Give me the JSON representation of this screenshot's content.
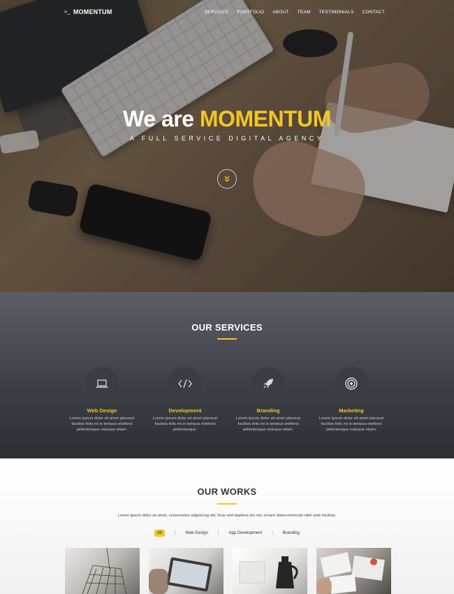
{
  "brand": {
    "prompt": ">_",
    "name": "MOMENTUM"
  },
  "nav": {
    "items": [
      "SERVICES",
      "PORTFOLIO",
      "ABOUT",
      "TEAM",
      "TESTIMONIALS",
      "CONTACT"
    ]
  },
  "hero": {
    "headline_prefix": "We are ",
    "headline_accent": "MOMENTUM",
    "tagline": "A FULL SERVICE DIGITAL AGENCY",
    "scroll_icon": "chevron-double-down-icon"
  },
  "services": {
    "title_light": "OUR ",
    "title_bold": "SERVICES",
    "items": [
      {
        "icon": "laptop-icon",
        "name": "Web Design",
        "desc": "Lorem ipsum dolor sit amet placerat facilisis felis mi in tempus eleifend pellentesque natoque etiam."
      },
      {
        "icon": "code-icon",
        "name": "Development",
        "desc": "Lorem ipsum dolor sit amet placerat facilisis felis mi in tempus eleifend pellentesque."
      },
      {
        "icon": "rocket-icon",
        "name": "Branding",
        "desc": "Lorem ipsum dolor sit amet placerat facilisis felis mi in tempus eleifend pellentesque natoque etiam."
      },
      {
        "icon": "target-icon",
        "name": "Marketing",
        "desc": "Lorem ipsum dolor sit amet placerat facilisis felis mi in tempus eleifend pellentesque natoque etiam."
      }
    ]
  },
  "works": {
    "title_light": "OUR ",
    "title_bold": "WORKS",
    "intro": "Lorem ipsum dolor sit amet, consectetur adipiscing elit. Duis sed dapibus leo nec ornare diamcommodo nibh ante facilisis.",
    "filters": [
      "All",
      "Web Design",
      "App Development",
      "Branding"
    ],
    "active_filter": "All"
  },
  "colors": {
    "accent": "#f3c623",
    "dark": "#3d4046"
  }
}
